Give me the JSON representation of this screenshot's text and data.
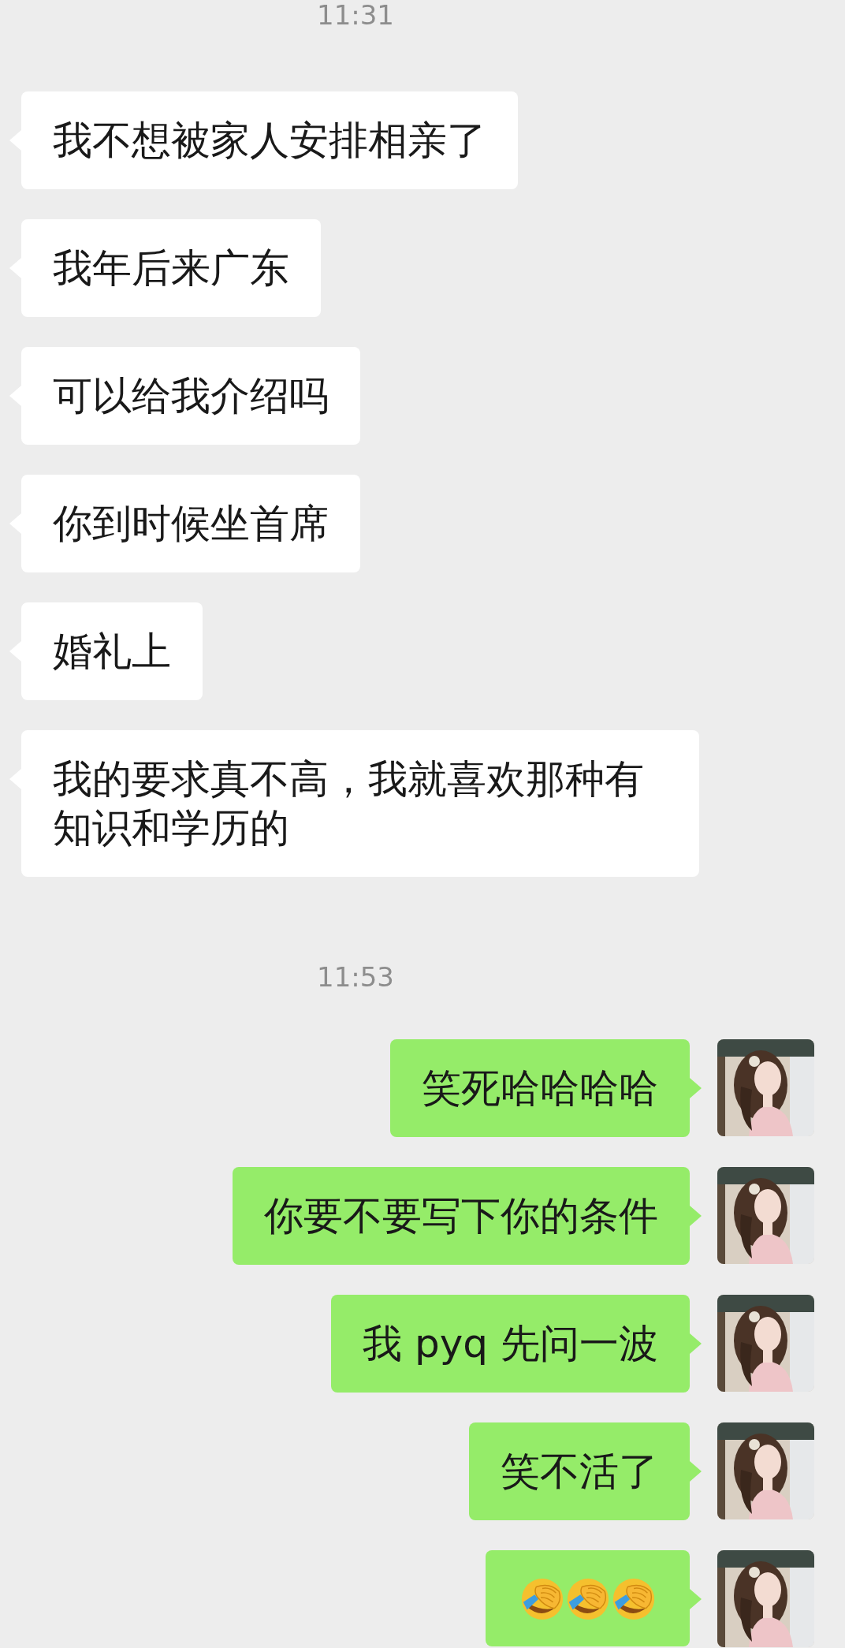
{
  "messages": [
    {
      "kind": "time",
      "text": "11:31"
    },
    {
      "kind": "received",
      "text": "我不想被家人安排相亲了"
    },
    {
      "kind": "received",
      "text": "我年后来广东"
    },
    {
      "kind": "received",
      "text": "可以给我介绍吗"
    },
    {
      "kind": "received",
      "text": "你到时候坐首席"
    },
    {
      "kind": "received",
      "text": "婚礼上"
    },
    {
      "kind": "received",
      "text": "我的要求真不高，我就喜欢那种有知识和学历的"
    },
    {
      "kind": "time",
      "text": "11:53"
    },
    {
      "kind": "sent",
      "text": "笑死哈哈哈哈"
    },
    {
      "kind": "sent",
      "text": "你要不要写下你的条件"
    },
    {
      "kind": "sent",
      "text": "我 pyq 先问一波"
    },
    {
      "kind": "sent",
      "text": "笑不活了"
    },
    {
      "kind": "sent",
      "emojis": [
        {
          "kind": "facepalm"
        },
        {
          "kind": "facepalm"
        },
        {
          "kind": "facepalm"
        }
      ]
    }
  ]
}
